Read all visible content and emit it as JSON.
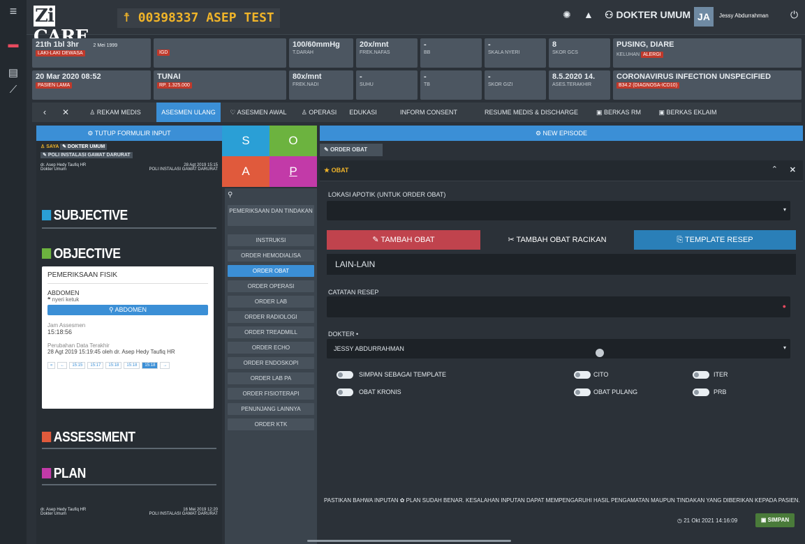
{
  "topbar": {
    "brand": "CARE",
    "patient": "00398337 ASEP TEST",
    "role": "DOKTER UMUM",
    "avatar": "JA",
    "user": "Jessy Abdurrahman"
  },
  "info": {
    "age": "21th 1bl 3hr",
    "dob": "2 Mei 1999",
    "category": "LAKI-LAKI DEWASA",
    "unit": "IGD",
    "bp": "100/60mmHg",
    "bp_l": "T.DARAH",
    "rr": "20x/mnt",
    "rr_l": "FREK.NAFAS",
    "bb_v": "-",
    "bb": "BB",
    "pain_v": "-",
    "pain": "SKALA NYERI",
    "gcs_v": "8",
    "gcs": "SKOR GCS",
    "complaint": "PUSING, DIARE",
    "complaint_l": "KELUHAN",
    "alergi": "ALERGI",
    "visit": "20 Mar 2020 08:52",
    "visit_l": "PASIEN LAMA",
    "payer": "TUNAI",
    "amount": "RP. 1.325.000",
    "hr": "80x/mnt",
    "hr_l": "FREK.NADI",
    "suhu_v": "-",
    "suhu": "SUHU",
    "tb_v": "-",
    "tb": "TB",
    "gizi_v": "-",
    "gizi": "SKOR GIZI",
    "last": "8.5.2020 14.",
    "last_l": "ASES.TERAKHIR",
    "dx": "CORONAVIRUS INFECTION UNSPECIFIED",
    "dx_code": "B34.2 (DIAGNOSA-ICD10)"
  },
  "tabs": [
    "REKAM MEDIS",
    "ASESMEN ULANG",
    "ASESMEN AWAL",
    "OPERASI",
    "EDUKASI",
    "INFORM CONSENT",
    "RESUME MEDIS & DISCHARGE",
    "BERKAS RM",
    "BERKAS EKLAIM"
  ],
  "left": {
    "close_form": "TUTUP FORMULIR INPUT",
    "tag_me": "SAYA",
    "tag_role": "DOKTER UMUM",
    "tag_unit": "POLI INSTALASI GAWAT DARURAT",
    "doc1": "dr. Asep Hedy Taufiq HR",
    "doc1_role": "Dokter Umum",
    "doc1_time": "28 Agt 2019 15:15",
    "doc1_unit": "POLI INSTALASI GAWAT DARURAT",
    "s": "SUBJECTIVE",
    "o": "OBJECTIVE",
    "a": "ASSESSMENT",
    "p": "PLAN",
    "doc2": "dr. Asep Hedy Taufiq HR",
    "doc2_role": "Dokter Umum",
    "doc2_time": "16 Mei 2019 12:20",
    "doc2_unit": "POLI INSTALASI GAWAT DARURAT"
  },
  "card": {
    "title": "PEMERIKSAAN FISIK",
    "section": "ABDOMEN",
    "note": "nyeri ketuk",
    "btn": "ABDOMEN",
    "jam_l": "Jam Assesmen",
    "jam": "15:18:56",
    "chg_l": "Perubahan Data Terakhir",
    "chg": "28 Agt 2019 15:19:45 oleh dr. Asep Hedy Taufiq HR",
    "pages": [
      "«",
      "←",
      "15:15",
      "15:17",
      "15:18",
      "15:18",
      "15:18",
      "→"
    ]
  },
  "soap": [
    "S",
    "O",
    "A",
    "P"
  ],
  "menu": [
    "PEMERIKSAAN DAN TINDAKAN",
    "INSTRUKSI",
    "ORDER HEMODIALISA",
    "ORDER OBAT",
    "ORDER OPERASI",
    "ORDER LAB",
    "ORDER RADIOLOGI",
    "ORDER TREADMILL",
    "ORDER ECHO",
    "ORDER ENDOSKOPI",
    "ORDER LAB PA",
    "ORDER FISIOTERAPI",
    "PENUNJANG LAINNYA",
    "ORDER KTK"
  ],
  "right": {
    "new_episode": "NEW EPISODE",
    "order_title": "ORDER OBAT",
    "obat": "OBAT",
    "lokasi": "LOKASI APOTIK (UNTUK ORDER OBAT)",
    "btn_tambah": "TAMBAH OBAT",
    "btn_racikan": "TAMBAH OBAT RACIKAN",
    "btn_template": "TEMPLATE RESEP",
    "lain": "LAIN-LAIN",
    "catatan": "CATATAN RESEP",
    "dokter": "DOKTER",
    "dokter_val": "JESSY ABDURRAHMAN",
    "t_simpan": "SIMPAN SEBAGAI TEMPLATE",
    "t_cito": "CITO",
    "t_iter": "ITER",
    "t_kronis": "OBAT KRONIS",
    "t_pulang": "OBAT PULANG",
    "t_prb": "PRB",
    "warning": "PASTIKAN BAHWA INPUTAN ✿ PLAN SUDAH BENAR. KESALAHAN INPUTAN DAPAT MEMPENGARUHI HASIL PENGAMATAN MAUPUN TINDAKAN YANG DIBERIKAN KEPADA PASIEN.",
    "timestamp": "21 Okt 2021 14:16:09",
    "save": "SIMPAN"
  },
  "colors": {
    "accent": "#3b8fd6",
    "s": "#2a9fd6",
    "o": "#6cb33f",
    "a": "#e05a3c",
    "p": "#c23aa8",
    "patient": "#f0b429"
  }
}
